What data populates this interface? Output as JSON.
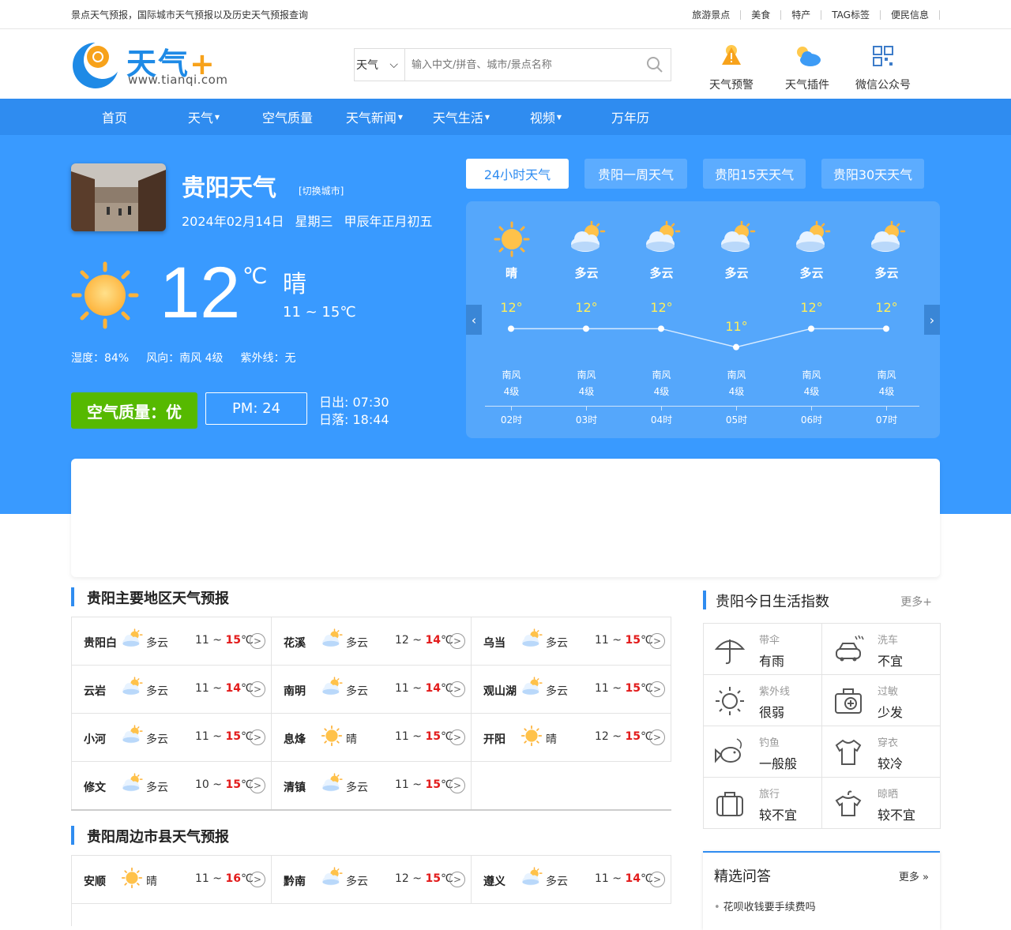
{
  "topbar": {
    "slogan": "景点天气预报，国际城市天气预报以及历史天气预报查询",
    "links": [
      "旅游景点",
      "美食",
      "特产",
      "TAG标签",
      "便民信息"
    ]
  },
  "header": {
    "logo_text": "天气",
    "logo_plus": "+",
    "logo_url": "www.tianqi.com",
    "search_select": "天气",
    "search_placeholder": "输入中文/拼音、城市/景点名称",
    "icons": [
      "天气预警",
      "天气插件",
      "微信公众号"
    ]
  },
  "nav": [
    "首页",
    "天气",
    "空气质量",
    "天气新闻",
    "天气生活",
    "视频",
    "万年历"
  ],
  "current": {
    "city": "贵阳天气",
    "switch_label": "[切换城市]",
    "date": "2024年02月14日",
    "weekday": "星期三",
    "lunar": "甲辰年正月初五",
    "temp": "12",
    "unit": "℃",
    "weather": "晴",
    "range": "11 ~ 15℃",
    "humidity": "湿度：84%",
    "wind": "风向：南风 4级",
    "uv": "紫外线：无",
    "aqi": "空气质量：优",
    "pm": "PM: 24",
    "sunrise": "日出: 07:30",
    "sunset": "日落: 18:44"
  },
  "tabs": [
    "24小时天气",
    "贵阳一周天气",
    "贵阳15天天气",
    "贵阳30天天气"
  ],
  "hourly": [
    {
      "weather": "晴",
      "icon": "sun-icon",
      "temp_label": "12°",
      "temp": 12,
      "wind": "南风",
      "level": "4级",
      "hour": "02时"
    },
    {
      "weather": "多云",
      "icon": "cloudy-icon",
      "temp_label": "12°",
      "temp": 12,
      "wind": "南风",
      "level": "4级",
      "hour": "03时"
    },
    {
      "weather": "多云",
      "icon": "cloudy-icon",
      "temp_label": "12°",
      "temp": 12,
      "wind": "南风",
      "level": "4级",
      "hour": "04时"
    },
    {
      "weather": "多云",
      "icon": "cloudy-icon",
      "temp_label": "11°",
      "temp": 11,
      "wind": "南风",
      "level": "4级",
      "hour": "05时"
    },
    {
      "weather": "多云",
      "icon": "cloudy-icon",
      "temp_label": "12°",
      "temp": 12,
      "wind": "南风",
      "level": "4级",
      "hour": "06时"
    },
    {
      "weather": "多云",
      "icon": "cloudy-icon",
      "temp_label": "12°",
      "temp": 12,
      "wind": "南风",
      "level": "4级",
      "hour": "07时"
    }
  ],
  "main_areas": {
    "title": "贵阳主要地区天气预报",
    "items": [
      {
        "name": "贵阳白",
        "weather": "多云",
        "icon": "cloudy-icon",
        "low": "11 ~ ",
        "high": "15",
        "unit": "℃"
      },
      {
        "name": "花溪",
        "weather": "多云",
        "icon": "cloudy-icon",
        "low": "12 ~ ",
        "high": "14",
        "unit": "℃"
      },
      {
        "name": "乌当",
        "weather": "多云",
        "icon": "cloudy-icon",
        "low": "11 ~ ",
        "high": "15",
        "unit": "℃"
      },
      {
        "name": "云岩",
        "weather": "多云",
        "icon": "cloudy-icon",
        "low": "11 ~ ",
        "high": "14",
        "unit": "℃"
      },
      {
        "name": "南明",
        "weather": "多云",
        "icon": "cloudy-icon",
        "low": "11 ~ ",
        "high": "14",
        "unit": "℃"
      },
      {
        "name": "观山湖",
        "weather": "多云",
        "icon": "cloudy-icon",
        "low": "11 ~ ",
        "high": "15",
        "unit": "℃"
      },
      {
        "name": "小河",
        "weather": "多云",
        "icon": "cloudy-icon",
        "low": "11 ~ ",
        "high": "15",
        "unit": "℃"
      },
      {
        "name": "息烽",
        "weather": "晴",
        "icon": "sun-icon",
        "low": "11 ~ ",
        "high": "15",
        "unit": "℃"
      },
      {
        "name": "开阳",
        "weather": "晴",
        "icon": "sun-icon",
        "low": "12 ~ ",
        "high": "15",
        "unit": "℃"
      },
      {
        "name": "修文",
        "weather": "多云",
        "icon": "cloudy-icon",
        "low": "10 ~ ",
        "high": "15",
        "unit": "℃"
      },
      {
        "name": "清镇",
        "weather": "多云",
        "icon": "cloudy-icon",
        "low": "11 ~ ",
        "high": "15",
        "unit": "℃"
      }
    ]
  },
  "nearby": {
    "title": "贵阳周边市县天气预报",
    "items": [
      {
        "name": "安顺",
        "weather": "晴",
        "icon": "sun-icon",
        "low": "11 ~ ",
        "high": "16",
        "unit": "℃"
      },
      {
        "name": "黔南",
        "weather": "多云",
        "icon": "cloudy-icon",
        "low": "12 ~ ",
        "high": "15",
        "unit": "℃"
      },
      {
        "name": "遵义",
        "weather": "多云",
        "icon": "cloudy-icon",
        "low": "11 ~ ",
        "high": "14",
        "unit": "℃"
      }
    ]
  },
  "life": {
    "title": "贵阳今日生活指数",
    "more": "更多+",
    "items": [
      {
        "title": "带伞",
        "value": "有雨",
        "icon": "umbrella-icon"
      },
      {
        "title": "洗车",
        "value": "不宜",
        "icon": "car-wash-icon"
      },
      {
        "title": "紫外线",
        "value": "很弱",
        "icon": "uv-icon"
      },
      {
        "title": "过敏",
        "value": "少发",
        "icon": "allergy-icon"
      },
      {
        "title": "钓鱼",
        "value": "一般般",
        "icon": "fishing-icon"
      },
      {
        "title": "穿衣",
        "value": "较冷",
        "icon": "clothing-icon"
      },
      {
        "title": "旅行",
        "value": "较不宜",
        "icon": "suitcase-icon"
      },
      {
        "title": "晾晒",
        "value": "较不宜",
        "icon": "drying-icon"
      }
    ]
  },
  "qa": {
    "title": "精选问答",
    "more": "更多",
    "first": "花呗收钱要手续费吗"
  }
}
